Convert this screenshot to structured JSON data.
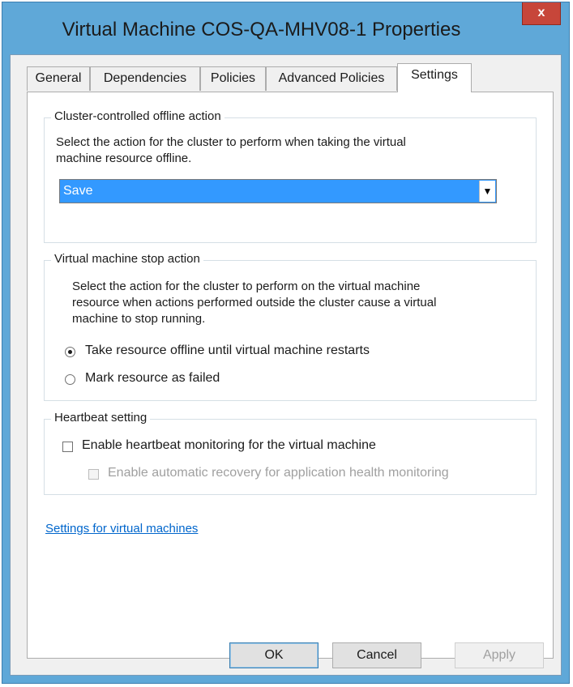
{
  "window": {
    "title": "Virtual Machine COS-QA-MHV08-1 Properties",
    "close_label": "x"
  },
  "tabs": [
    {
      "label": "General"
    },
    {
      "label": "Dependencies"
    },
    {
      "label": "Policies"
    },
    {
      "label": "Advanced Policies"
    },
    {
      "label": "Settings",
      "active": true
    }
  ],
  "offline_action": {
    "legend": "Cluster-controlled offline action",
    "description_line1": "Select the action for the cluster to perform when taking the virtual",
    "description_line2": "machine resource offline.",
    "selected": "Save"
  },
  "stop_action": {
    "legend": "Virtual machine stop action",
    "description_line1": "Select the action for the cluster to perform on the virtual machine",
    "description_line2": "resource when actions performed outside the cluster cause a virtual",
    "description_line3": "machine to stop running.",
    "options": [
      {
        "label": "Take resource offline until virtual machine restarts",
        "checked": true
      },
      {
        "label": "Mark resource as failed",
        "checked": false
      }
    ]
  },
  "heartbeat": {
    "legend": "Heartbeat setting",
    "enable_label": "Enable heartbeat monitoring for the virtual machine",
    "enable_checked": false,
    "recovery_label": "Enable automatic recovery for application health monitoring",
    "recovery_checked": false,
    "recovery_enabled": false
  },
  "settings_link": "Settings for virtual machines",
  "buttons": {
    "ok": "OK",
    "cancel": "Cancel",
    "apply": "Apply"
  },
  "colors": {
    "title_bar": "#5fa8d8",
    "selection": "#3399ff",
    "close": "#c7463a",
    "link": "#0066cc"
  }
}
